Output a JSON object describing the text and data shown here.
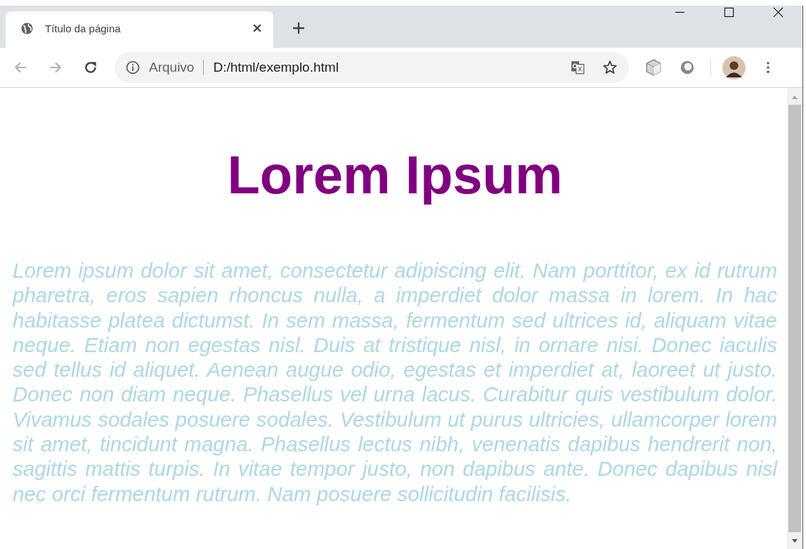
{
  "tabs": [
    {
      "title": "Título da página",
      "selected": true
    }
  ],
  "address_bar": {
    "scheme_label": "Arquivo",
    "url": "D:/html/exemplo.html"
  },
  "page": {
    "heading": "Lorem Ipsum",
    "paragraph": "Lorem ipsum dolor sit amet, consectetur adipiscing elit. Nam porttitor, ex id rutrum pharetra, eros sapien rhoncus nulla, a imperdiet dolor massa in lorem. In hac habitasse platea dictumst. In sem massa, fermentum sed ultrices id, aliquam vitae neque. Etiam non egestas nisl. Duis at tristique nisl, in ornare nisi. Donec iaculis sed tellus id aliquet. Aenean augue odio, egestas et imperdiet at, laoreet ut justo. Donec non diam neque. Phasellus vel urna lacus. Curabitur quis vestibulum dolor. Vivamus sodales posuere sodales. Vestibulum ut purus ultricies, ullamcorper lorem sit amet, tincidunt magna. Phasellus lectus nibh, venenatis dapibus hendrerit non, sagittis mattis turpis. In vitae tempor justo, non dapibus ante. Donec dapibus nisl nec orci fermentum rutrum. Nam posuere sollicitudin facilisis."
  }
}
